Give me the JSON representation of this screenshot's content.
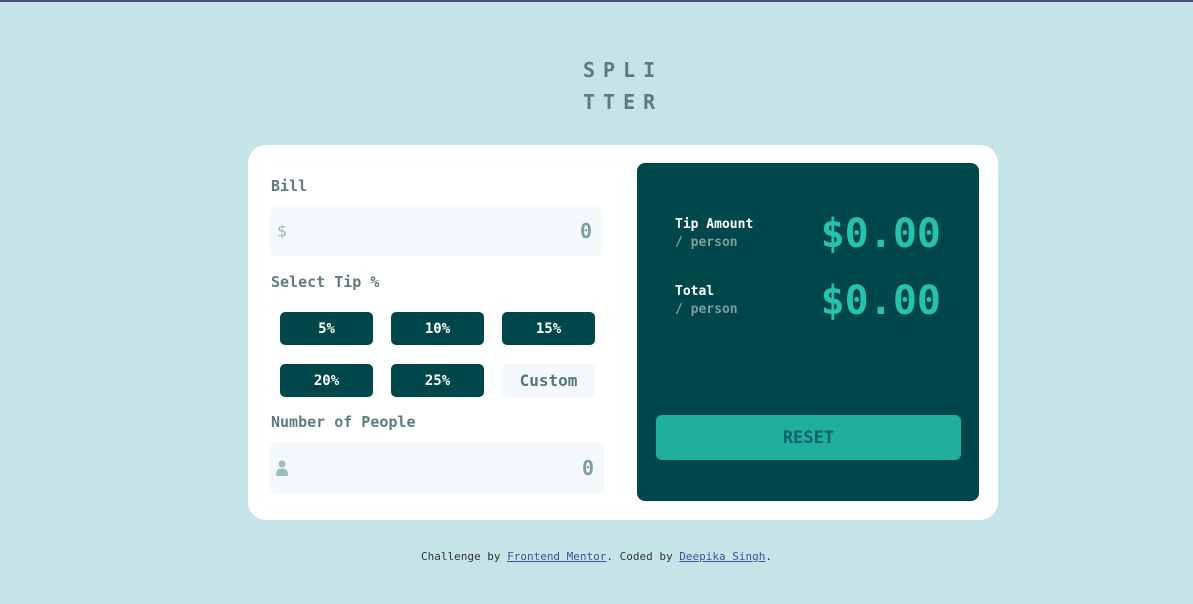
{
  "logo": {
    "line1": "SPLI",
    "line2": "TTER"
  },
  "bill": {
    "label": "Bill",
    "currency_symbol": "$",
    "value": "0"
  },
  "tip": {
    "label": "Select Tip %",
    "options": [
      "5%",
      "10%",
      "15%",
      "20%",
      "25%"
    ],
    "custom_label": "Custom"
  },
  "people": {
    "label": "Number of People",
    "value": "0",
    "icon": "person-icon"
  },
  "result": {
    "tip_amount": {
      "title": "Tip Amount",
      "subtitle": "/ person",
      "value": "$0.00"
    },
    "total": {
      "title": "Total",
      "subtitle": "/ person",
      "value": "$0.00"
    },
    "reset_label": "RESET"
  },
  "footer": {
    "prefix": "Challenge by ",
    "link1": "Frontend Mentor",
    "middle": ". Coded by ",
    "link2": "Deepika Singh",
    "suffix": "."
  },
  "colors": {
    "background": "#c5e4e7",
    "dark_cyan": "#00474b",
    "accent": "#26c2ad",
    "input_bg": "#f3f9fa"
  }
}
